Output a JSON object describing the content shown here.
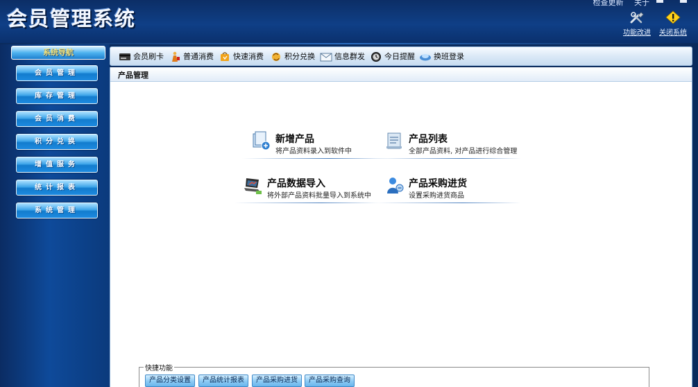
{
  "app": {
    "title": "会员管理系统",
    "top_links": [
      "检查更新",
      "关于"
    ]
  },
  "header_tools": [
    {
      "id": "feature-improve",
      "label": "功能改进",
      "icon": "tools-icon"
    },
    {
      "id": "close-system",
      "label": "关闭系统",
      "icon": "warning-icon"
    }
  ],
  "sidebar": {
    "header": "系统导航",
    "items": [
      {
        "label": "会员管理"
      },
      {
        "label": "库存管理"
      },
      {
        "label": "会员消费"
      },
      {
        "label": "积分兑换"
      },
      {
        "label": "增值服务"
      },
      {
        "label": "统计报表"
      },
      {
        "label": "系统管理"
      }
    ]
  },
  "toolbar": {
    "items": [
      {
        "label": "会员刷卡",
        "icon": "card-reader-icon"
      },
      {
        "label": "普通消费",
        "icon": "shopper-icon"
      },
      {
        "label": "快速消费",
        "icon": "fast-shop-icon"
      },
      {
        "label": "积分兑换",
        "icon": "exchange-icon"
      },
      {
        "label": "信息群发",
        "icon": "mail-icon"
      },
      {
        "label": "今日提醒",
        "icon": "clock-icon"
      },
      {
        "label": "换班登录",
        "icon": "shift-icon"
      }
    ]
  },
  "panel": {
    "title": "产品管理",
    "functions": [
      {
        "title": "新增产品",
        "desc": "将产品资料录入到软件中",
        "icon": "add-product-icon"
      },
      {
        "title": "产品列表",
        "desc": "全部产品资料, 对产品进行综合管理",
        "icon": "product-list-icon"
      },
      {
        "title": "产品数据导入",
        "desc": "将外部产品资料批量导入到系统中",
        "icon": "import-laptop-icon"
      },
      {
        "title": "产品采购进货",
        "desc": "设置采购进货商品",
        "icon": "purchase-icon"
      }
    ],
    "quick": {
      "legend": "快捷功能",
      "buttons": [
        "产品分类设置",
        "产品统计报表",
        "产品采购进货",
        "产品采购查询"
      ]
    }
  },
  "colors": {
    "header_bg": "#0f3f86",
    "sidebar_bg": "#0e4a9a",
    "nav_button": "#3fa6ea",
    "nav_header_text": "#f5e47a"
  }
}
